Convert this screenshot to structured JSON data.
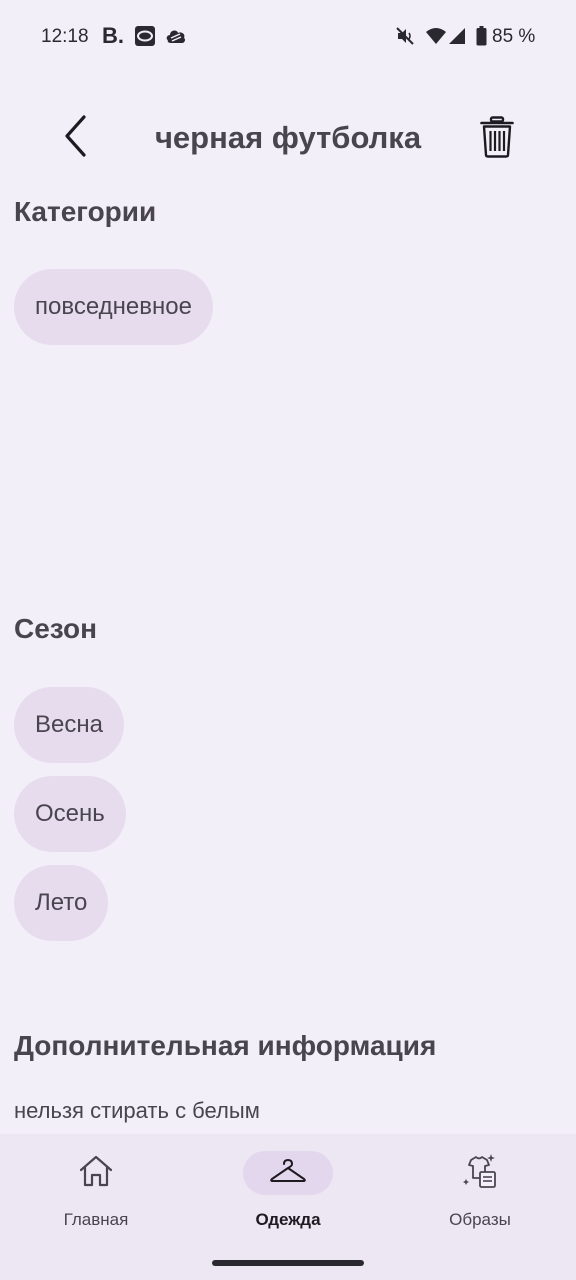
{
  "status_bar": {
    "time": "12:18",
    "battery_text": "85 %",
    "left_icons": [
      "booking-b-icon",
      "image-app-icon",
      "cloud-app-icon"
    ],
    "right_icons": [
      "mute-icon",
      "wifi-icon",
      "cellular-signal-icon",
      "battery-icon"
    ]
  },
  "header": {
    "title": "черная футболка",
    "back_icon": "chevron-left-icon",
    "delete_icon": "trash-icon"
  },
  "categories": {
    "title": "Категории",
    "chips": [
      "повседневное"
    ]
  },
  "season": {
    "title": "Сезон",
    "chips": [
      "Весна",
      "Осень",
      "Лето"
    ]
  },
  "additional": {
    "title": "Дополнительная информация",
    "text": "нельзя стирать с белым"
  },
  "bottom_nav": {
    "items": [
      {
        "label": "Главная",
        "icon": "home-icon",
        "active": false
      },
      {
        "label": "Одежда",
        "icon": "hanger-icon",
        "active": true
      },
      {
        "label": "Образы",
        "icon": "outfits-icon",
        "active": false
      }
    ]
  },
  "colors": {
    "background": "#f3eff8",
    "chip": "#e7dcee",
    "nav_background": "#ede6f3",
    "nav_indicator": "#e3d7ee",
    "text": "#49454f"
  }
}
